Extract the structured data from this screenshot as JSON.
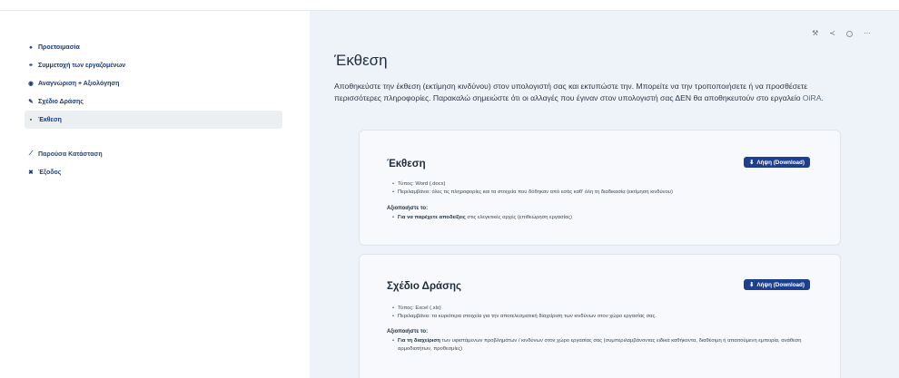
{
  "sidebar": {
    "items": [
      {
        "icon": "home-icon",
        "glyph": "♠",
        "label": "Προετοιμασία"
      },
      {
        "icon": "users-icon",
        "glyph": "⚭",
        "label": "Συμμετοχή των εργαζομένων"
      },
      {
        "icon": "target-icon",
        "glyph": "◉",
        "label": "Αναγνώριση + Αξιολόγηση"
      },
      {
        "icon": "pencil-icon",
        "glyph": "✎",
        "label": "Σχέδιο Δράσης"
      },
      {
        "icon": "document-icon",
        "glyph": "▪",
        "label": "Έκθεση"
      }
    ],
    "secondary": [
      {
        "icon": "chart-icon",
        "glyph": "⟋",
        "label": "Παρούσα Κατάσταση"
      },
      {
        "icon": "close-icon",
        "glyph": "✖",
        "label": "Έξοδος"
      }
    ]
  },
  "toolbar": {
    "tools_icon": "⚒",
    "share_icon": "≺",
    "more_icon": "⋯"
  },
  "main": {
    "title": "Έκθεση",
    "intro": "Αποθηκεύστε την έκθεση (εκτίμηση κινδύνου) στον υπολογιστή σας και εκτυπώστε την. Μπορείτε να την τροποποιήσετε ή να προσθέσετε περισσότερες πληροφορίες. Παρακαλώ σημειώστε ότι οι αλλαγές που έγιναν στον υπολογιστή σας ΔΕΝ θα αποθηκευτούν στο εργαλείο ",
    "intro_tool": "OiRA",
    "intro_end": "."
  },
  "cards": [
    {
      "title": "Έκθεση",
      "download_label": "Λήψη (Download)",
      "info": [
        "Τύπος: Word (.docx)",
        "Περιλαμβάνει: όλες τις πληροφορίες και τα στοιχεία που δόθηκαν από εσάς καθ' όλη τη διαδικασία (εκτίμηση κινδύνου)"
      ],
      "use_label": "Αξιοποιήστε το:",
      "use_bold": "Για να παρέχετε αποδείξεις",
      "use_rest": " στις ελεγκτικές αρχές (επιθεώρηση εργασίας)"
    },
    {
      "title": "Σχέδιο Δράσης",
      "download_label": "Λήψη (Download)",
      "info": [
        "Τύπος: Excel (.xls)",
        "Περιλαμβάνει: τα κυριότερα στοιχεία για την αποτελεσματική διαχείριση των κινδύνων στον χώρο εργασίας σας."
      ],
      "use_label": "Αξιοποιήστε το:",
      "use_bold": "Για τη διαχείριση",
      "use_rest": " των υφιστάμενων προβλημάτων / κινδύνων στον χώρο εργασίας σας (συμπεριλαμβάνοντας ειδικά καθήκοντα, διαθέσιμη ή απαιτούμενη εμπειρία, ανάθεση αρμοδιοτήτων, προθεσμίες)"
    }
  ]
}
